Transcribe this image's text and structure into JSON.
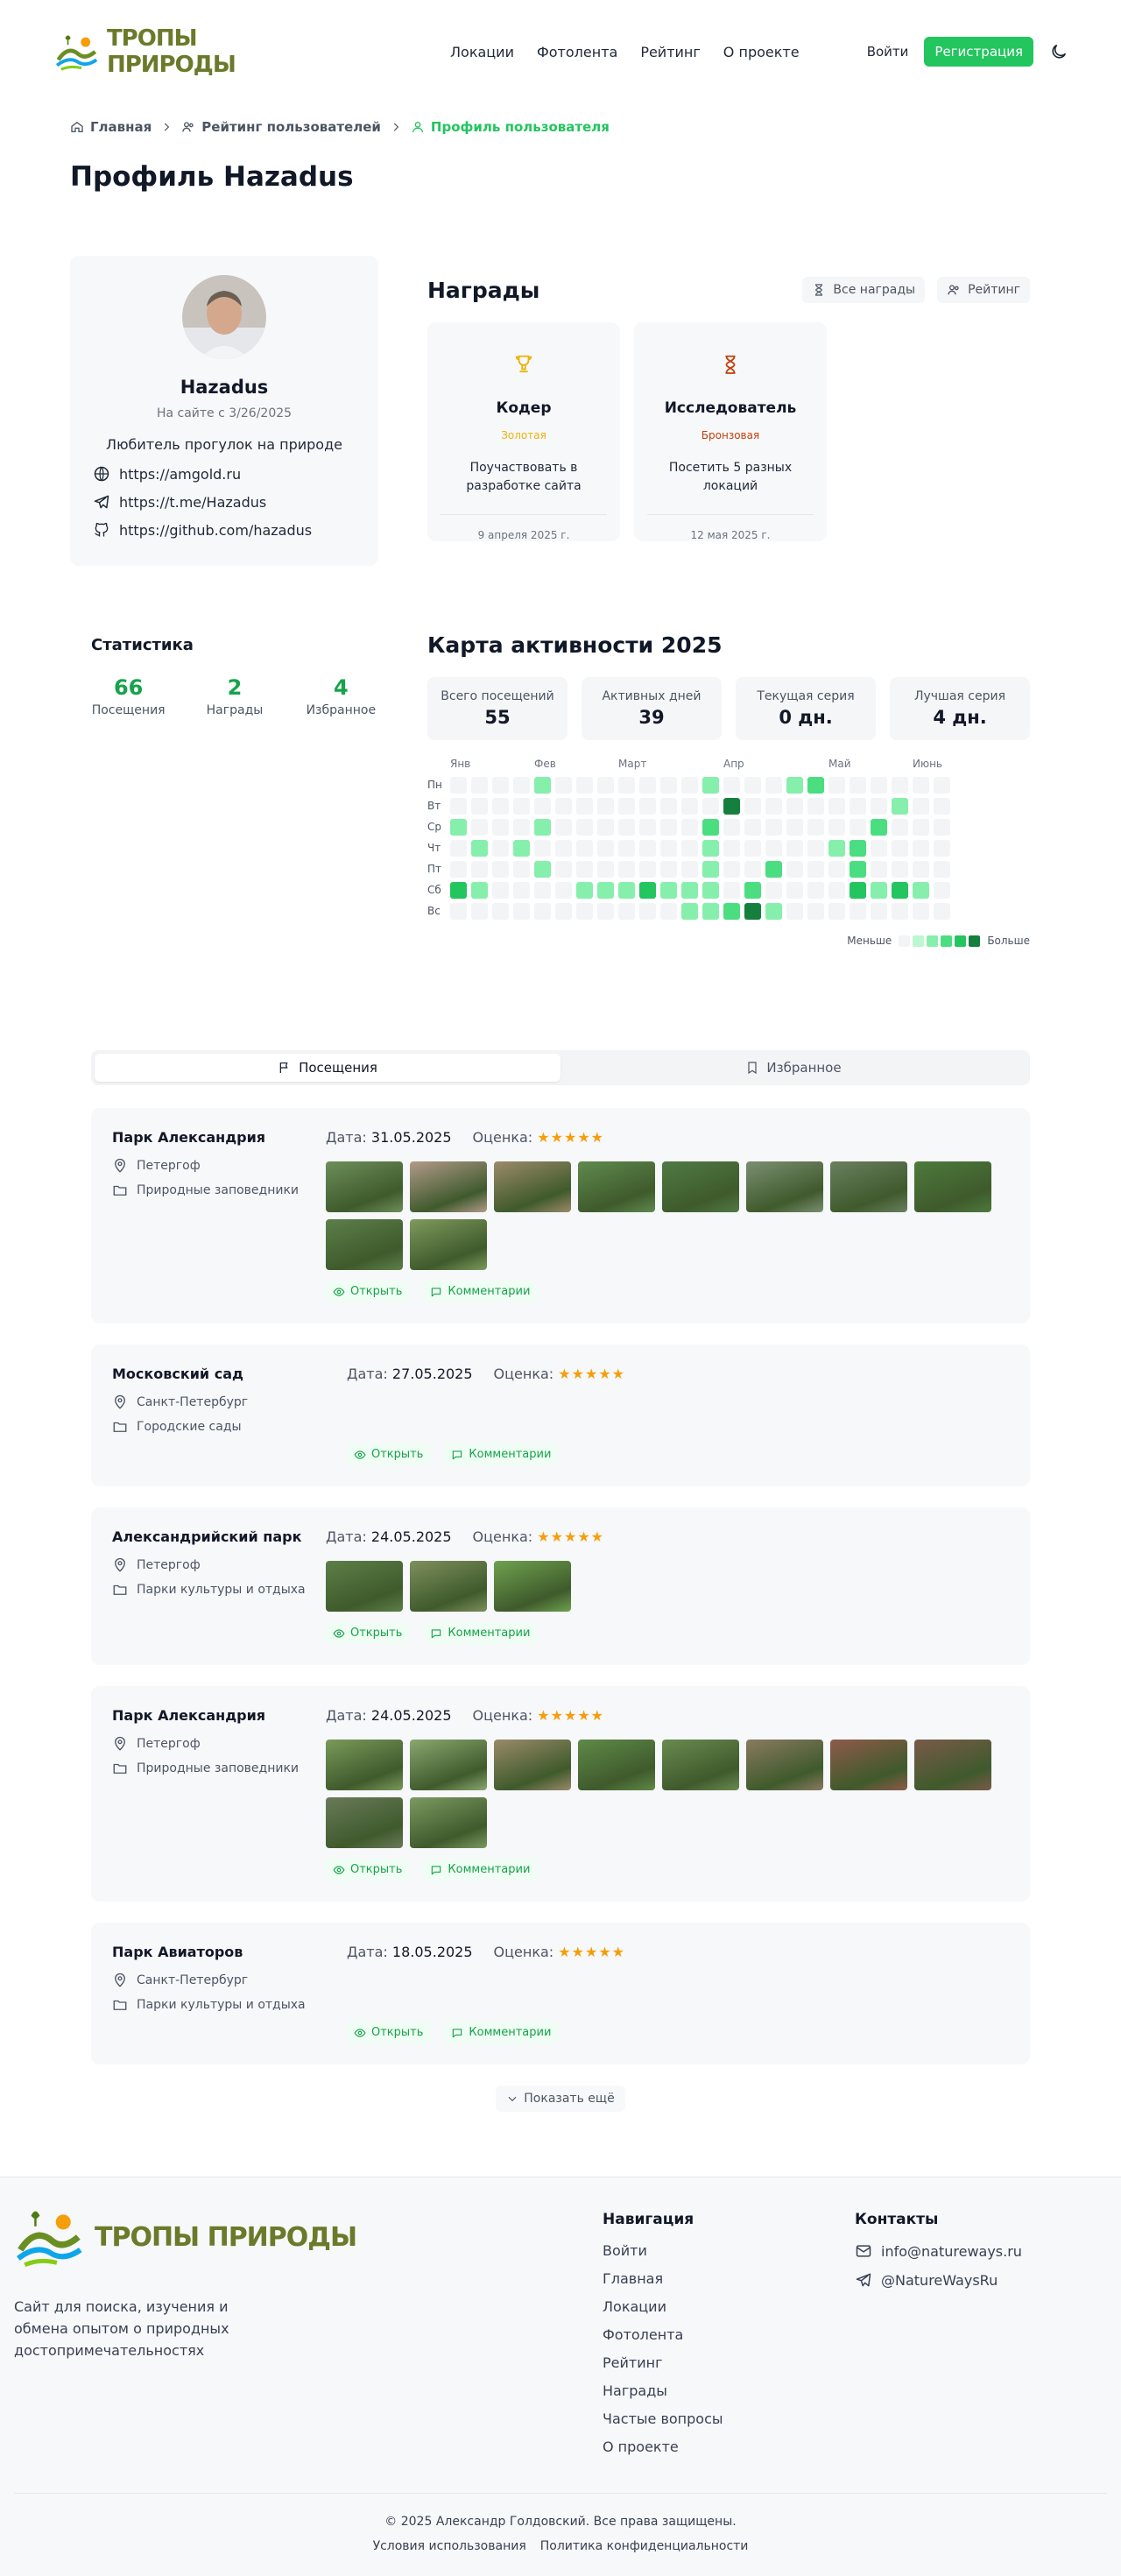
{
  "header": {
    "logo_text": "ТРОПЫ ПРИРОДЫ",
    "nav": [
      "Локации",
      "Фотолента",
      "Рейтинг",
      "О проекте"
    ],
    "login": "Войти",
    "register": "Регистрация",
    "theme_icon": "moon-icon"
  },
  "breadcrumb": [
    "Главная",
    "Рейтинг пользователей",
    "Профиль пользователя"
  ],
  "page_title": "Профиль Hazadus",
  "profile": {
    "name": "Hazadus",
    "since": "На сайте с 3/26/2025",
    "bio": "Любитель прогулок на природе",
    "links": [
      {
        "icon": "globe-icon",
        "text": "https://amgold.ru"
      },
      {
        "icon": "telegram-icon",
        "text": "https://t.me/Hazadus"
      },
      {
        "icon": "github-icon",
        "text": "https://github.com/hazadus"
      }
    ]
  },
  "awards": {
    "title": "Награды",
    "all_btn": "Все награды",
    "rating_btn": "Рейтинг",
    "items": [
      {
        "name": "Кодер",
        "tier": "Золотая",
        "tier_color": "#eab308",
        "desc": "Поучаствовать в разработке сайта",
        "date": "9 апреля 2025 г."
      },
      {
        "name": "Исследователь",
        "tier": "Бронзовая",
        "tier_color": "#c2410c",
        "desc": "Посетить 5 разных локаций",
        "date": "12 мая 2025 г."
      }
    ]
  },
  "stats": {
    "title": "Статистика",
    "items": [
      {
        "value": "66",
        "label": "Посещения"
      },
      {
        "value": "2",
        "label": "Награды"
      },
      {
        "value": "4",
        "label": "Избранное"
      }
    ]
  },
  "activity": {
    "title": "Карта активности 2025",
    "summary": [
      {
        "label": "Всего посещений",
        "value": "55"
      },
      {
        "label": "Активных дней",
        "value": "39"
      },
      {
        "label": "Текущая серия",
        "value": "0 дн."
      },
      {
        "label": "Лучшая серия",
        "value": "4 дн."
      }
    ],
    "months": [
      "Янв",
      "Фев",
      "Март",
      "Апр",
      "Май",
      "Июнь"
    ],
    "days": [
      "Пн",
      "Вт",
      "Ср",
      "Чт",
      "Пт",
      "Сб",
      "Вс"
    ],
    "legend_less": "Меньше",
    "legend_more": "Больше",
    "colors": [
      "#f3f4f6",
      "#bbf7d0",
      "#86efac",
      "#4ade80",
      "#22c55e",
      "#15803d"
    ],
    "grid": [
      [
        0,
        0,
        0,
        0,
        2,
        0,
        0,
        0,
        0,
        0,
        0,
        0,
        2,
        0,
        0,
        0,
        2,
        3,
        0,
        0,
        0,
        0,
        0,
        0
      ],
      [
        0,
        0,
        0,
        0,
        0,
        0,
        0,
        0,
        0,
        0,
        0,
        0,
        0,
        5,
        0,
        0,
        0,
        0,
        0,
        0,
        0,
        2,
        0,
        0
      ],
      [
        2,
        0,
        0,
        0,
        2,
        0,
        0,
        0,
        0,
        0,
        0,
        0,
        3,
        0,
        0,
        0,
        0,
        0,
        0,
        0,
        3,
        0,
        0,
        0
      ],
      [
        0,
        2,
        0,
        2,
        0,
        0,
        0,
        0,
        0,
        0,
        0,
        0,
        2,
        0,
        0,
        0,
        0,
        0,
        2,
        3,
        0,
        0,
        0,
        0
      ],
      [
        0,
        0,
        0,
        0,
        2,
        0,
        0,
        0,
        0,
        0,
        0,
        0,
        2,
        0,
        0,
        3,
        0,
        0,
        0,
        3,
        0,
        0,
        0,
        0
      ],
      [
        4,
        2,
        0,
        0,
        0,
        0,
        2,
        2,
        2,
        4,
        2,
        2,
        2,
        0,
        3,
        0,
        0,
        0,
        0,
        4,
        2,
        4,
        2,
        0
      ],
      [
        0,
        0,
        0,
        0,
        0,
        0,
        0,
        0,
        0,
        0,
        0,
        2,
        2,
        3,
        5,
        2,
        0,
        0,
        0,
        0,
        0,
        0,
        0,
        0
      ]
    ]
  },
  "tabs": [
    {
      "label": "Посещения",
      "icon": "flag-icon",
      "active": true
    },
    {
      "label": "Избранное",
      "icon": "bookmark-icon",
      "active": false
    }
  ],
  "visits": [
    {
      "name": "Парк Александрия",
      "city": "Петергоф",
      "category": "Природные заповедники",
      "date": "31.05.2025",
      "stars": "★★★★★",
      "photos": [
        "#6d8f5a",
        "#b29a8a",
        "#9c8a6a",
        "#5f8a4e",
        "#4f7a45",
        "#7b8f72",
        "#6a7f60",
        "#4d7a3c",
        "#5c7f4a",
        "#7e9a5c"
      ]
    },
    {
      "name": "Московский сад",
      "city": "Санкт-Петербург",
      "category": "Городские сады",
      "date": "27.05.2025",
      "stars": "★★★★★",
      "photos": []
    },
    {
      "name": "Александрийский парк",
      "city": "Петергоф",
      "category": "Парки культуры и отдыха",
      "date": "24.05.2025",
      "stars": "★★★★★",
      "photos": [
        "#5d7f48",
        "#7e8f5c",
        "#6ea14f"
      ]
    },
    {
      "name": "Парк Александрия",
      "city": "Петергоф",
      "category": "Природные заповедники",
      "date": "24.05.2025",
      "stars": "★★★★★",
      "photos": [
        "#7a9a5a",
        "#8aa870",
        "#9a8a6a",
        "#5f8a48",
        "#6a8a50",
        "#8a7a60",
        "#8f5a4a",
        "#7a5a4a",
        "#6a7a5a",
        "#7c9a62"
      ]
    },
    {
      "name": "Парк Авиаторов",
      "city": "Санкт-Петербург",
      "category": "Парки культуры и отдыха",
      "date": "18.05.2025",
      "stars": "★★★★★",
      "photos": []
    }
  ],
  "visit_labels": {
    "date": "Дата:",
    "rating": "Оценка:",
    "open": "Открыть",
    "comments": "Комментарии"
  },
  "show_more": "Показать ещё",
  "footer": {
    "logo_text": "ТРОПЫ ПРИРОДЫ",
    "desc": "Сайт для поиска, изучения и обмена опытом о природных достопримечательностях",
    "nav_title": "Навигация",
    "nav": [
      "Войти",
      "Главная",
      "Локации",
      "Фотолента",
      "Рейтинг",
      "Награды",
      "Частые вопросы",
      "О проекте"
    ],
    "contacts_title": "Контакты",
    "email": "info@natureways.ru",
    "telegram": "@NatureWaysRu",
    "copyright": "© 2025 Александр Голдовский. Все права защищены.",
    "terms": "Условия использования",
    "privacy": "Политика конфиденциальности"
  }
}
